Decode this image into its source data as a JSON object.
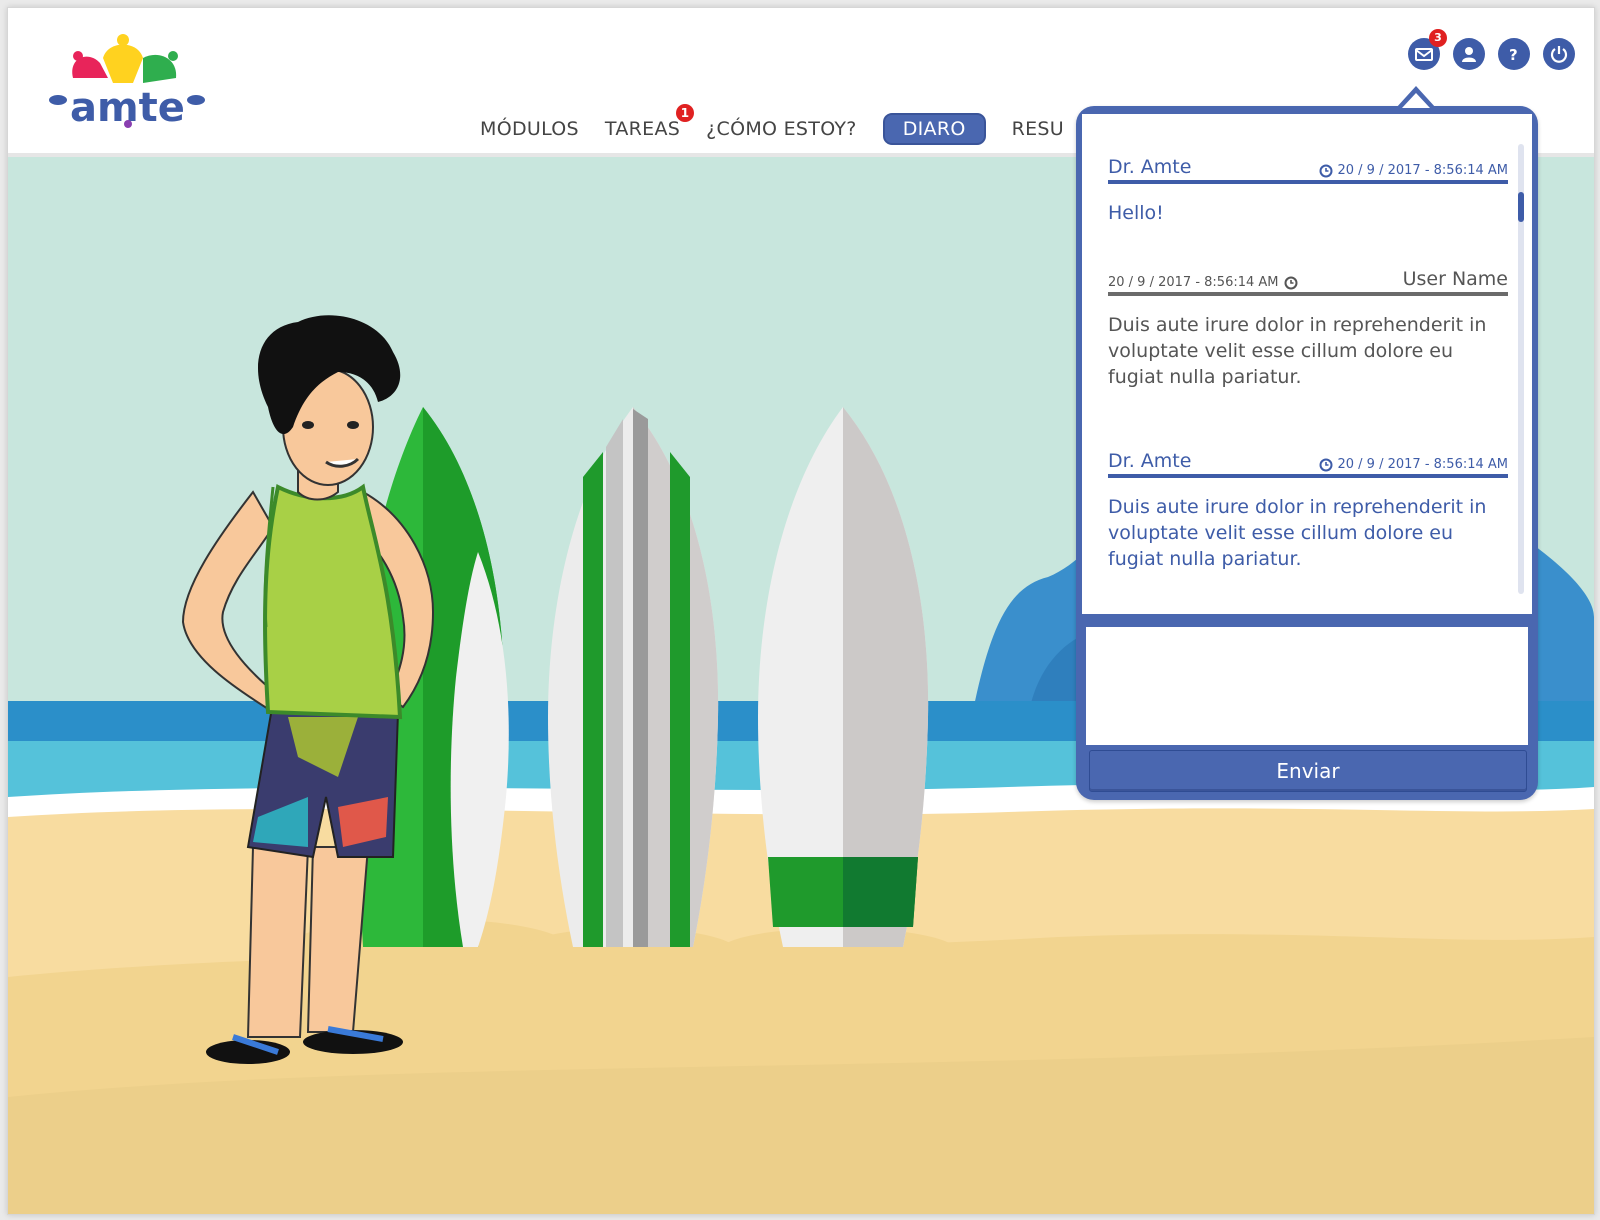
{
  "app": {
    "logo_text": "amte"
  },
  "nav": {
    "items": [
      {
        "label": "MÓDULOS",
        "active": false
      },
      {
        "label": "TAREAS",
        "active": false,
        "badge": "1"
      },
      {
        "label": "¿CÓMO ESTOY?",
        "active": false
      },
      {
        "label": "DIARO",
        "active": true
      },
      {
        "label": "RESU",
        "active": false
      }
    ]
  },
  "top_icons": {
    "mail": {
      "icon": "mail-icon",
      "badge": "3"
    },
    "profile": {
      "icon": "user-icon"
    },
    "help": {
      "icon": "help-icon"
    },
    "logout": {
      "icon": "power-icon"
    }
  },
  "chat": {
    "messages": [
      {
        "sender": "Dr. Amte",
        "timestamp": "20 / 9 / 2017 - 8:56:14 AM",
        "body": "Hello!",
        "from": "doctor"
      },
      {
        "sender": "User Name",
        "timestamp": "20 / 9 / 2017 - 8:56:14 AM",
        "body": "Duis aute irure dolor in reprehenderit in voluptate velit esse cillum dolore eu fugiat nulla pariatur.",
        "from": "user"
      },
      {
        "sender": "Dr. Amte",
        "timestamp": "20 / 9 / 2017 - 8:56:14 AM",
        "body": "Duis aute irure dolor in reprehenderit in voluptate velit esse cillum dolore eu fugiat nulla pariatur.",
        "from": "doctor"
      }
    ],
    "reply_value": "",
    "send_label": "Enviar"
  },
  "colors": {
    "brand_blue": "#4a67b0",
    "badge_red": "#e02121",
    "sky": "#c8e6dd",
    "sea": "#4fbfd8",
    "sand": "#f6d99a"
  }
}
